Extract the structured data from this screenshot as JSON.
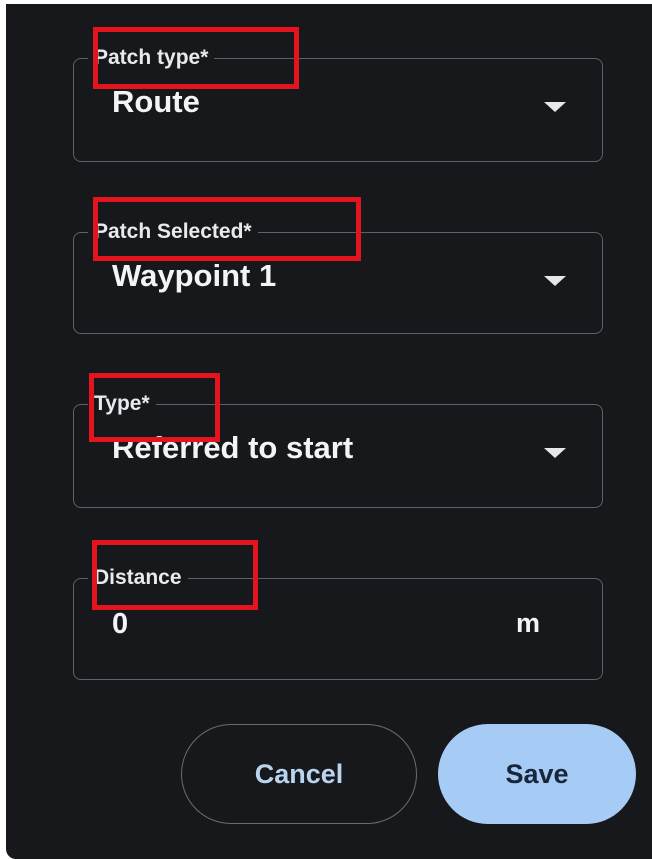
{
  "form": {
    "patch_type": {
      "label": "Patch type*",
      "value": "Route"
    },
    "patch_selected": {
      "label": "Patch Selected*",
      "value": "Waypoint 1"
    },
    "type": {
      "label": "Type*",
      "value": "Referred to start"
    },
    "distance": {
      "label": "Distance",
      "value": "0",
      "unit": "m"
    }
  },
  "actions": {
    "cancel_label": "Cancel",
    "save_label": "Save"
  },
  "colors": {
    "background": "#17181c",
    "field_border": "#5f6166",
    "highlight": "#e4141e",
    "save_button": "#a6ccf5",
    "cancel_text": "#b9d4ef"
  },
  "icons": {
    "dropdown": "chevron-down-icon"
  }
}
